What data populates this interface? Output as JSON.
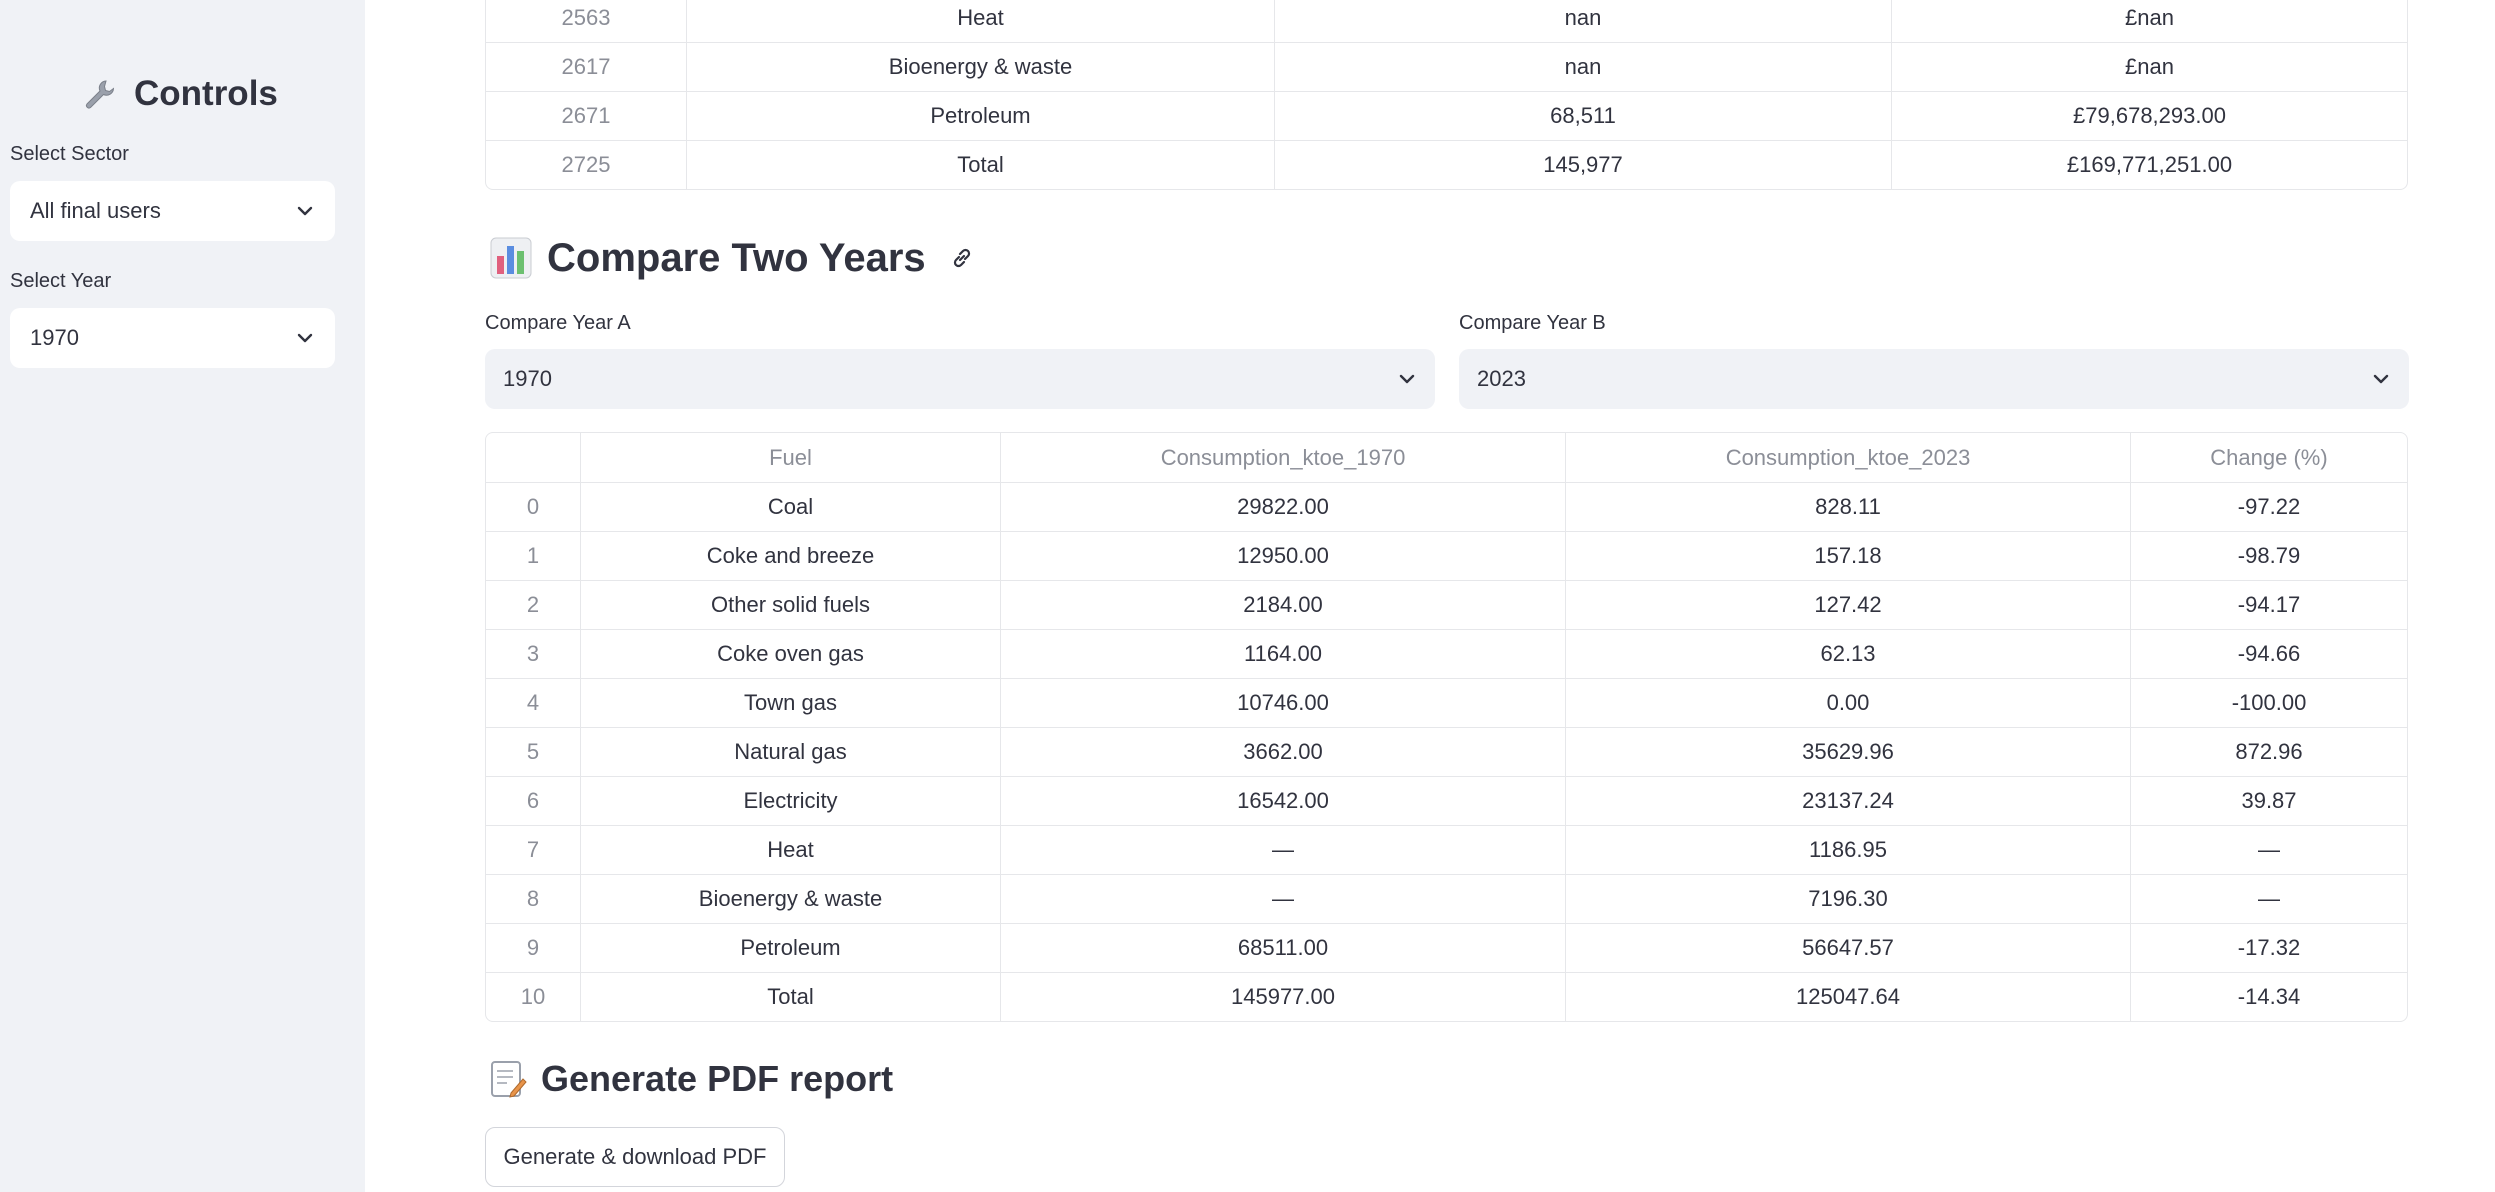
{
  "sidebar": {
    "title": "Controls",
    "title_icon": "wrench-icon",
    "sector_label": "Select Sector",
    "sector_value": "All final users",
    "year_label": "Select Year",
    "year_value": "1970"
  },
  "top_table": {
    "rows": [
      [
        "2563",
        "Heat",
        "nan",
        "£nan"
      ],
      [
        "2617",
        "Bioenergy & waste",
        "nan",
        "£nan"
      ],
      [
        "2671",
        "Petroleum",
        "68,511",
        "£79,678,293.00"
      ],
      [
        "2725",
        "Total",
        "145,977",
        "£169,771,251.00"
      ]
    ]
  },
  "compare": {
    "title": "Compare Two Years",
    "title_icon": "bar-chart-icon",
    "year_a_label": "Compare Year A",
    "year_a_value": "1970",
    "year_b_label": "Compare Year B",
    "year_b_value": "2023",
    "headers": [
      "",
      "Fuel",
      "Consumption_ktoe_1970",
      "Consumption_ktoe_2023",
      "Change (%)"
    ],
    "rows": [
      [
        "0",
        "Coal",
        "29822.00",
        "828.11",
        "-97.22"
      ],
      [
        "1",
        "Coke and breeze",
        "12950.00",
        "157.18",
        "-98.79"
      ],
      [
        "2",
        "Other solid fuels",
        "2184.00",
        "127.42",
        "-94.17"
      ],
      [
        "3",
        "Coke oven gas",
        "1164.00",
        "62.13",
        "-94.66"
      ],
      [
        "4",
        "Town gas",
        "10746.00",
        "0.00",
        "-100.00"
      ],
      [
        "5",
        "Natural gas",
        "3662.00",
        "35629.96",
        "872.96"
      ],
      [
        "6",
        "Electricity",
        "16542.00",
        "23137.24",
        "39.87"
      ],
      [
        "7",
        "Heat",
        "—",
        "1186.95",
        "—"
      ],
      [
        "8",
        "Bioenergy & waste",
        "—",
        "7196.30",
        "—"
      ],
      [
        "9",
        "Petroleum",
        "68511.00",
        "56647.57",
        "-17.32"
      ],
      [
        "10",
        "Total",
        "145977.00",
        "125047.64",
        "-14.34"
      ]
    ]
  },
  "pdf": {
    "title": "Generate PDF report",
    "title_icon": "memo-icon",
    "button_label": "Generate & download PDF"
  },
  "colors": {
    "sidebar_bg": "#f0f2f6",
    "text": "#31333f",
    "muted": "#8b8e97",
    "border": "#e6e7ea"
  }
}
